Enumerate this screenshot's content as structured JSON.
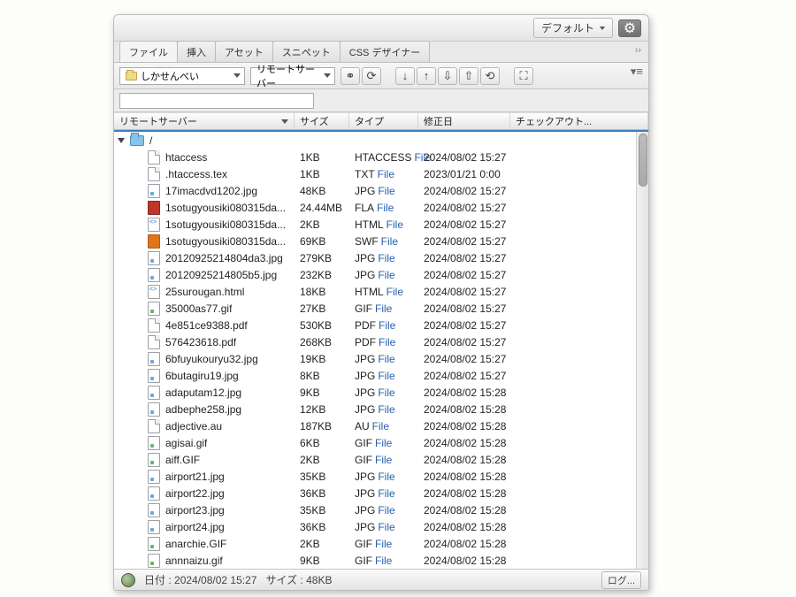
{
  "titlebar": {
    "layout_dropdown": "デフォルト"
  },
  "tabs": [
    "ファイル",
    "挿入",
    "アセット",
    "スニペット",
    "CSS デザイナー"
  ],
  "toolbar": {
    "site_dropdown": "しかせんべい",
    "server_dropdown": "リモートサーバー"
  },
  "search_placeholder": "",
  "columns": {
    "name": "リモートサーバー",
    "size": "サイズ",
    "type": "タイプ",
    "modified": "修正日",
    "checkout": "チェックアウト..."
  },
  "root_label": "/",
  "files": [
    {
      "icon": "doc",
      "name": "htaccess",
      "size": "1KB",
      "type_a": "HTACCESS",
      "type_b": "File",
      "date": "2024/08/02 15:27"
    },
    {
      "icon": "doc",
      "name": ".htaccess.tex",
      "size": "1KB",
      "type_a": "TXT",
      "type_b": "File",
      "date": "2023/01/21 0:00"
    },
    {
      "icon": "img",
      "name": "17imacdvd1202.jpg",
      "size": "48KB",
      "type_a": "JPG",
      "type_b": "File",
      "date": "2024/08/02 15:27"
    },
    {
      "icon": "fla",
      "name": "1sotugyousiki080315da...",
      "size": "24.44MB",
      "type_a": "FLA",
      "type_b": "File",
      "date": "2024/08/02 15:27"
    },
    {
      "icon": "html",
      "name": "1sotugyousiki080315da...",
      "size": "2KB",
      "type_a": "HTML",
      "type_b": "File",
      "date": "2024/08/02 15:27"
    },
    {
      "icon": "swf",
      "name": "1sotugyousiki080315da...",
      "size": "69KB",
      "type_a": "SWF",
      "type_b": "File",
      "date": "2024/08/02 15:27"
    },
    {
      "icon": "img",
      "name": "20120925214804da3.jpg",
      "size": "279KB",
      "type_a": "JPG",
      "type_b": "File",
      "date": "2024/08/02 15:27"
    },
    {
      "icon": "img",
      "name": "20120925214805b5.jpg",
      "size": "232KB",
      "type_a": "JPG",
      "type_b": "File",
      "date": "2024/08/02 15:27"
    },
    {
      "icon": "html",
      "name": "25surougan.html",
      "size": "18KB",
      "type_a": "HTML",
      "type_b": "File",
      "date": "2024/08/02 15:27"
    },
    {
      "icon": "gif",
      "name": "35000as77.gif",
      "size": "27KB",
      "type_a": "GIF",
      "type_b": "File",
      "date": "2024/08/02 15:27"
    },
    {
      "icon": "pdf",
      "name": "4e851ce9388.pdf",
      "size": "530KB",
      "type_a": "PDF",
      "type_b": "File",
      "date": "2024/08/02 15:27"
    },
    {
      "icon": "pdf",
      "name": "576423618.pdf",
      "size": "268KB",
      "type_a": "PDF",
      "type_b": "File",
      "date": "2024/08/02 15:27"
    },
    {
      "icon": "img",
      "name": "6bfuyukouryu32.jpg",
      "size": "19KB",
      "type_a": "JPG",
      "type_b": "File",
      "date": "2024/08/02 15:27"
    },
    {
      "icon": "img",
      "name": "6butagiru19.jpg",
      "size": "8KB",
      "type_a": "JPG",
      "type_b": "File",
      "date": "2024/08/02 15:27"
    },
    {
      "icon": "img",
      "name": "adaputam12.jpg",
      "size": "9KB",
      "type_a": "JPG",
      "type_b": "File",
      "date": "2024/08/02 15:28"
    },
    {
      "icon": "img",
      "name": "adbephe258.jpg",
      "size": "12KB",
      "type_a": "JPG",
      "type_b": "File",
      "date": "2024/08/02 15:28"
    },
    {
      "icon": "doc",
      "name": "adjective.au",
      "size": "187KB",
      "type_a": "AU",
      "type_b": "File",
      "date": "2024/08/02 15:28"
    },
    {
      "icon": "gif",
      "name": "agisai.gif",
      "size": "6KB",
      "type_a": "GIF",
      "type_b": "File",
      "date": "2024/08/02 15:28"
    },
    {
      "icon": "gif",
      "name": "aiff.GIF",
      "size": "2KB",
      "type_a": "GIF",
      "type_b": "File",
      "date": "2024/08/02 15:28"
    },
    {
      "icon": "img",
      "name": "airport21.jpg",
      "size": "35KB",
      "type_a": "JPG",
      "type_b": "File",
      "date": "2024/08/02 15:28"
    },
    {
      "icon": "img",
      "name": "airport22.jpg",
      "size": "36KB",
      "type_a": "JPG",
      "type_b": "File",
      "date": "2024/08/02 15:28"
    },
    {
      "icon": "img",
      "name": "airport23.jpg",
      "size": "35KB",
      "type_a": "JPG",
      "type_b": "File",
      "date": "2024/08/02 15:28"
    },
    {
      "icon": "img",
      "name": "airport24.jpg",
      "size": "36KB",
      "type_a": "JPG",
      "type_b": "File",
      "date": "2024/08/02 15:28"
    },
    {
      "icon": "gif",
      "name": "anarchie.GIF",
      "size": "2KB",
      "type_a": "GIF",
      "type_b": "File",
      "date": "2024/08/02 15:28"
    },
    {
      "icon": "gif",
      "name": "annnaizu.gif",
      "size": "9KB",
      "type_a": "GIF",
      "type_b": "File",
      "date": "2024/08/02 15:28"
    }
  ],
  "status": {
    "date_label": "日付 :",
    "date_value": "2024/08/02 15:27",
    "size_label": "サイズ :",
    "size_value": "48KB",
    "log_button": "ログ..."
  }
}
